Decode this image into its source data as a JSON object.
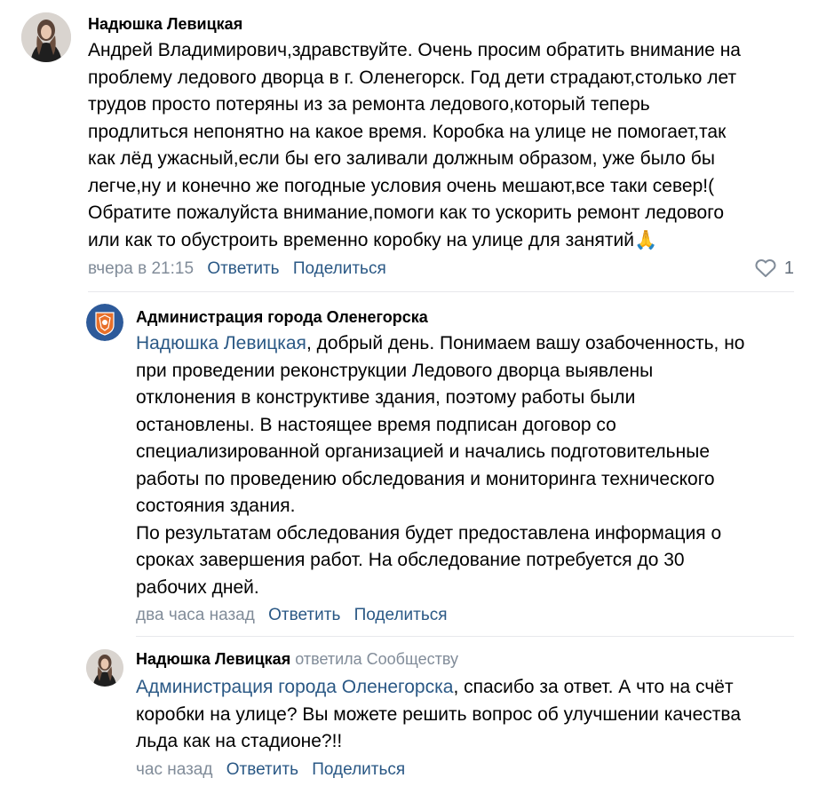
{
  "comments": [
    {
      "author": "Надюшка Левицкая",
      "lines": [
        "Андрей Владимирович,здравствуйте. Очень просим обратить внимание на",
        "проблему ледового дворца в г. Оленегорск. Год дети страдают,столько лет",
        "трудов просто потеряны из за ремонта ледового,который теперь",
        "продлиться непонятно на какое время. Коробка на улице не помогает,так",
        "как лёд ужасный,если бы его заливали должным образом, уже было бы",
        "легче,ну и конечно же погодные условия очень мешают,все таки север!(",
        "Обратите пожалуйста внимание,помоги как то ускорить ремонт ледового",
        "или как то обустроить временно коробку на улице для занятий"
      ],
      "emoji": "🙏",
      "time": "вчера в 21:15",
      "reply_label": "Ответить",
      "share_label": "Поделиться",
      "likes": "1"
    },
    {
      "author": "Администрация города Оленегорска",
      "mention": "Надюшка Левицкая",
      "first_line_rest": ", добрый день. Понимаем вашу озабоченность, но",
      "lines": [
        "при проведении реконструкции Ледового дворца выявлены",
        "отклонения в конструктиве здания, поэтому работы были",
        "остановлены. В настоящее время подписан договор со",
        "специализированной организацией и начались подготовительные",
        "работы по проведению обследования и мониторинга технического",
        "состояния здания.",
        "По результатам обследования будет предоставлена информация о",
        "сроках завершения работ. На обследование потребуется до 30",
        "рабочих дней."
      ],
      "time": "два часа назад",
      "reply_label": "Ответить",
      "share_label": "Поделиться"
    },
    {
      "author": "Надюшка Левицкая",
      "replied_to": "ответила Сообществу",
      "mention": "Администрация города Оленегорска",
      "first_line_rest": ", спасибо за ответ. А что на счёт",
      "lines": [
        "коробки на улице? Вы можете решить вопрос об улучшении качества",
        "льда как на стадионе?!!"
      ],
      "time": "час назад",
      "reply_label": "Ответить",
      "share_label": "Поделиться"
    }
  ],
  "colors": {
    "link": "#2a5885",
    "meta": "#818c99",
    "divider": "#e7e8ec",
    "crest_bg": "#2d5a9a",
    "crest_fg": "#e8702a"
  }
}
